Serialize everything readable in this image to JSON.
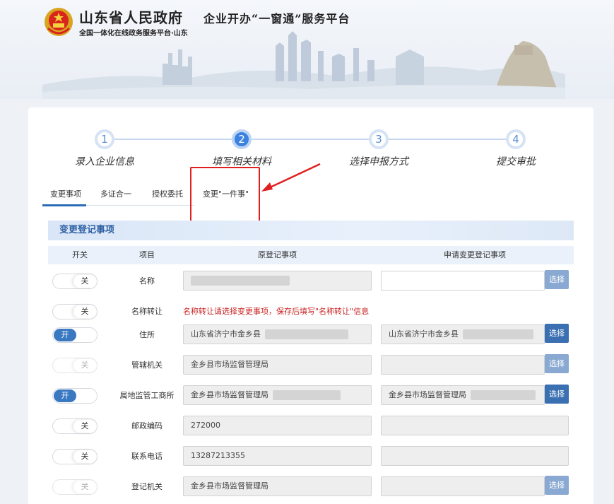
{
  "header": {
    "gov_title": "山东省人民政府",
    "gov_subtitle": "全国一体化在线政务服务平台·山东",
    "platform_title": "企业开办“一窗通”服务平台"
  },
  "steps": [
    {
      "num": "1",
      "label": "录入企业信息"
    },
    {
      "num": "2",
      "label": "填写相关材料"
    },
    {
      "num": "3",
      "label": "选择申报方式"
    },
    {
      "num": "4",
      "label": "提交审批"
    }
  ],
  "tabs": [
    {
      "label": "变更事项"
    },
    {
      "label": "多证合一"
    },
    {
      "label": "授权委托"
    },
    {
      "label": "变更\"一件事\""
    }
  ],
  "section": {
    "title": "变更登记事项"
  },
  "table_header": {
    "switch": "开关",
    "item": "项目",
    "original": "原登记事项",
    "requested": "申请变更登记事项"
  },
  "labels": {
    "on": "开",
    "off": "关",
    "select": "选择"
  },
  "rows": [
    {
      "label": "名称",
      "orig": "",
      "new": ""
    },
    {
      "label": "名称转让",
      "warning": "名称转让请选择变更事项，保存后填写\"名称转让\"信息"
    },
    {
      "label": "住所",
      "orig": "山东省济宁市金乡县",
      "new": "山东省济宁市金乡县"
    },
    {
      "label": "管辖机关",
      "orig": "金乡县市场监督管理局",
      "new": ""
    },
    {
      "label": "属地监管工商所",
      "orig": "金乡县市场监督管理局",
      "new": "金乡县市场监督管理局"
    },
    {
      "label": "邮政编码",
      "orig": "272000",
      "new": ""
    },
    {
      "label": "联系电话",
      "orig": "13287213355",
      "new": ""
    },
    {
      "label": "登记机关",
      "orig": "金乡县市场监督管理局",
      "new": ""
    }
  ],
  "colors": {
    "primary": "#3a78c2",
    "annotation": "#e02020",
    "section_text": "#2d5fa3"
  }
}
